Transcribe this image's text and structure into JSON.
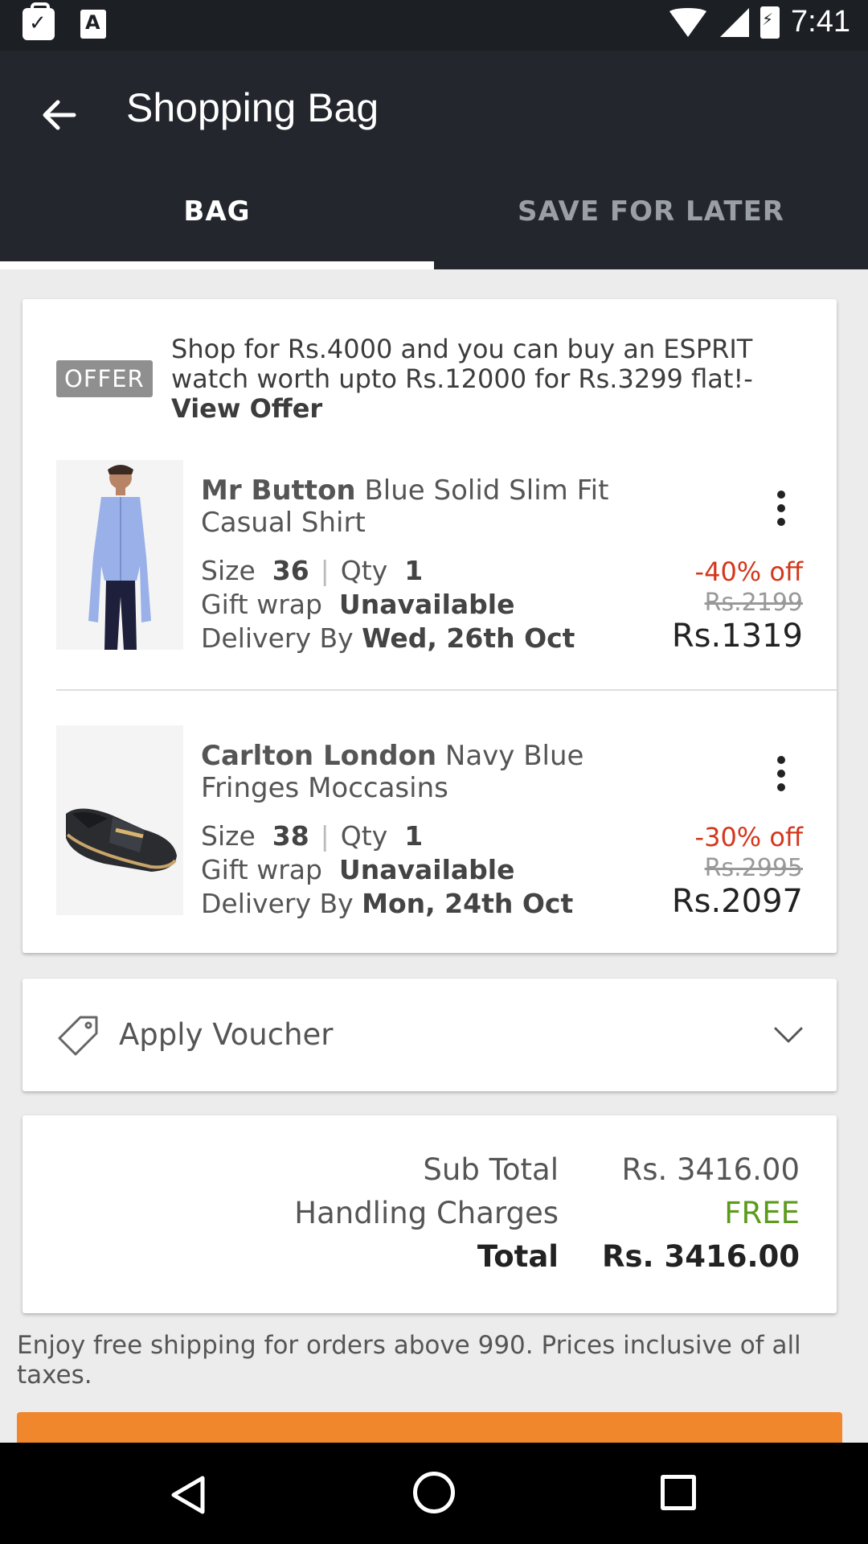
{
  "status_bar": {
    "time": "7:41"
  },
  "header": {
    "title": "Shopping Bag"
  },
  "tabs": [
    {
      "label": "BAG",
      "active": true
    },
    {
      "label": "SAVE FOR LATER",
      "active": false
    }
  ],
  "offer": {
    "badge": "OFFER",
    "text": "Shop for Rs.4000 and you can buy an ESPRIT watch worth upto Rs.12000 for Rs.3299 flat!-",
    "link": "View Offer"
  },
  "items": [
    {
      "brand": "Mr Button",
      "name": " Blue Solid Slim Fit Casual Shirt",
      "size_label": "Size",
      "size": "36",
      "qty_label": "Qty",
      "qty": "1",
      "gift_label": "Gift wrap",
      "gift": "Unavailable",
      "delivery_label": "Delivery By",
      "delivery": "Wed, 26th Oct",
      "discount": "-40% off",
      "mrp": "Rs.2199",
      "price": "Rs.1319"
    },
    {
      "brand": "Carlton London",
      "name": " Navy Blue Fringes Moccasins",
      "size_label": "Size",
      "size": "38",
      "qty_label": "Qty",
      "qty": "1",
      "gift_label": "Gift wrap",
      "gift": "Unavailable",
      "delivery_label": "Delivery By",
      "delivery": "Mon, 24th Oct",
      "discount": "-30% off",
      "mrp": "Rs.2995",
      "price": "Rs.2097"
    }
  ],
  "voucher": {
    "label": "Apply Voucher"
  },
  "totals": {
    "subtotal_label": "Sub Total",
    "subtotal": "Rs. 3416.00",
    "handling_label": "Handling Charges",
    "handling": "FREE",
    "total_label": "Total",
    "total": "Rs. 3416.00"
  },
  "footer_note": "Enjoy free shipping for orders above 990. Prices inclusive of all taxes.",
  "colors": {
    "accent": "#f0872c",
    "discount": "#d4371c",
    "free": "#5c9a1c",
    "appbar": "#23272d"
  }
}
